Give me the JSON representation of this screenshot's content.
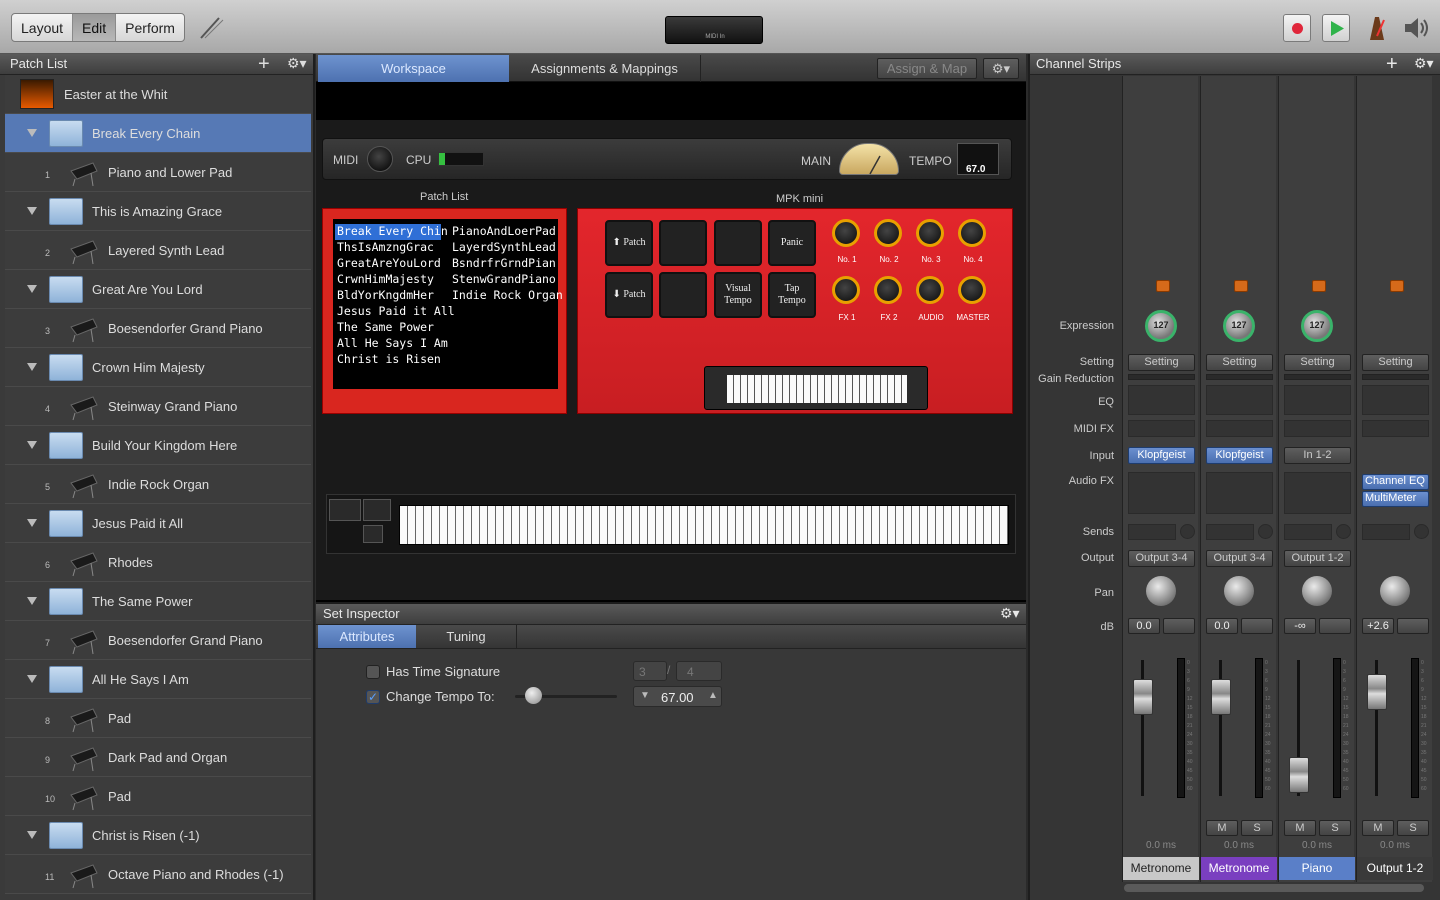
{
  "toolbar": {
    "modes": [
      "Layout",
      "Edit",
      "Perform"
    ],
    "midi_display": "MIDI In",
    "colors": {
      "record": "#e0263a",
      "play": "#2fb34a"
    }
  },
  "patch_list": {
    "title": "Patch List",
    "items": [
      {
        "kind": "concert",
        "label": "Easter at the Whit"
      },
      {
        "kind": "set",
        "label": "Break Every Chain",
        "selected": true
      },
      {
        "kind": "patch",
        "num": "1",
        "label": "Piano and Lower Pad"
      },
      {
        "kind": "set",
        "label": "This is Amazing Grace"
      },
      {
        "kind": "patch",
        "num": "2",
        "label": "Layered Synth Lead"
      },
      {
        "kind": "set",
        "label": "Great Are You Lord"
      },
      {
        "kind": "patch",
        "num": "3",
        "label": "Boesendorfer Grand Piano"
      },
      {
        "kind": "set",
        "label": "Crown Him Majesty"
      },
      {
        "kind": "patch",
        "num": "4",
        "label": "Steinway Grand Piano"
      },
      {
        "kind": "set",
        "label": "Build Your Kingdom Here"
      },
      {
        "kind": "patch",
        "num": "5",
        "label": "Indie Rock Organ"
      },
      {
        "kind": "set",
        "label": "Jesus Paid it All"
      },
      {
        "kind": "patch",
        "num": "6",
        "label": "Rhodes"
      },
      {
        "kind": "set",
        "label": "The Same Power"
      },
      {
        "kind": "patch",
        "num": "7",
        "label": "Boesendorfer Grand Piano"
      },
      {
        "kind": "set",
        "label": "All He Says I Am"
      },
      {
        "kind": "patch",
        "num": "8",
        "label": "Pad"
      },
      {
        "kind": "patch",
        "num": "9",
        "label": "Dark Pad and Organ"
      },
      {
        "kind": "patch",
        "num": "10",
        "label": "Pad"
      },
      {
        "kind": "set",
        "label": "Christ is Risen (-1)"
      },
      {
        "kind": "patch",
        "num": "11",
        "label": "Octave Piano and Rhodes (-1)"
      }
    ]
  },
  "workspace": {
    "tabs": [
      "Workspace",
      "Assignments & Mappings"
    ],
    "assign_map": "Assign & Map",
    "status": {
      "midi": "MIDI",
      "cpu": "CPU",
      "main": "MAIN",
      "tempo": "TEMPO",
      "tempo_value": "67.0"
    },
    "patch_list_title": "Patch List",
    "mpk_title": "MPK mini",
    "patch_display": {
      "left": [
        "Break Every Chin",
        "ThsIsAmzngGrac",
        "GreatAreYouLord",
        "CrwnHimMajesty",
        "BldYorKngdmHer",
        "Jesus Paid it All",
        "The Same Power",
        "All He Says I Am",
        "Christ is Risen"
      ],
      "right": [
        "PianoAndLoerPad",
        "LayerdSynthLead",
        "BsndrfrGrndPian",
        "StenwGrandPiano",
        "Indie Rock Organ"
      ]
    },
    "pads": {
      "patch_up": "⬆ Patch",
      "patch_down": "⬇ Patch",
      "visual_tempo": "Visual Tempo",
      "panic": "Panic",
      "tap_tempo": "Tap Tempo"
    },
    "knobs_top": [
      "No. 1",
      "No. 2",
      "No. 3",
      "No. 4"
    ],
    "knobs_bottom": [
      "FX 1",
      "FX 2",
      "AUDIO",
      "MASTER"
    ]
  },
  "inspector": {
    "title": "Set Inspector",
    "tabs": [
      "Attributes",
      "Tuning"
    ],
    "time_signature_label": "Has Time Signature",
    "time_sig_num": "3",
    "time_sig_den": "4",
    "tempo_label": "Change Tempo To:",
    "tempo_value": "67.00"
  },
  "channel_strips": {
    "title": "Channel Strips",
    "row_labels": {
      "expression": "Expression",
      "setting": "Setting",
      "gain_reduction": "Gain Reduction",
      "eq": "EQ",
      "midi_fx": "MIDI FX",
      "input": "Input",
      "audio_fx": "Audio FX",
      "sends": "Sends",
      "output": "Output",
      "pan": "Pan",
      "db": "dB"
    },
    "meter_scale": [
      "0",
      "3",
      "6",
      "9",
      "12",
      "15",
      "18",
      "21",
      "24",
      "30",
      "35",
      "40",
      "45",
      "50",
      "60"
    ],
    "strips": [
      {
        "expression": "127",
        "setting": "Setting",
        "input": "Klopfgeist",
        "output": "Output 3-4",
        "db": "0.0",
        "ms": "0.0 ms",
        "name": "Metronome",
        "name_color": "#c8c8c8",
        "fader_level": 0.8
      },
      {
        "expression": "127",
        "setting": "Setting",
        "input": "Klopfgeist",
        "output": "Output 3-4",
        "db": "0.0",
        "ms": "0.0 ms",
        "name": "Metronome",
        "name_color": "#7a3fc0",
        "fader_level": 0.8,
        "mute": "M",
        "solo": "S"
      },
      {
        "expression": "127",
        "setting": "Setting",
        "input": "In 1-2",
        "output": "Output 1-2",
        "db": "-∞",
        "ms": "0.0 ms",
        "name": "Piano",
        "name_color": "#5a7fc8",
        "fader_level": 0.05,
        "mute": "M",
        "solo": "S"
      },
      {
        "setting": "Setting",
        "audio_fx": [
          "Channel EQ",
          "MultiMeter"
        ],
        "db": "+2.6",
        "ms": "0.0 ms",
        "name": "Output 1-2",
        "name_color": "#3a3a3a",
        "fader_level": 0.85,
        "mute": "M",
        "solo": "S"
      }
    ]
  }
}
